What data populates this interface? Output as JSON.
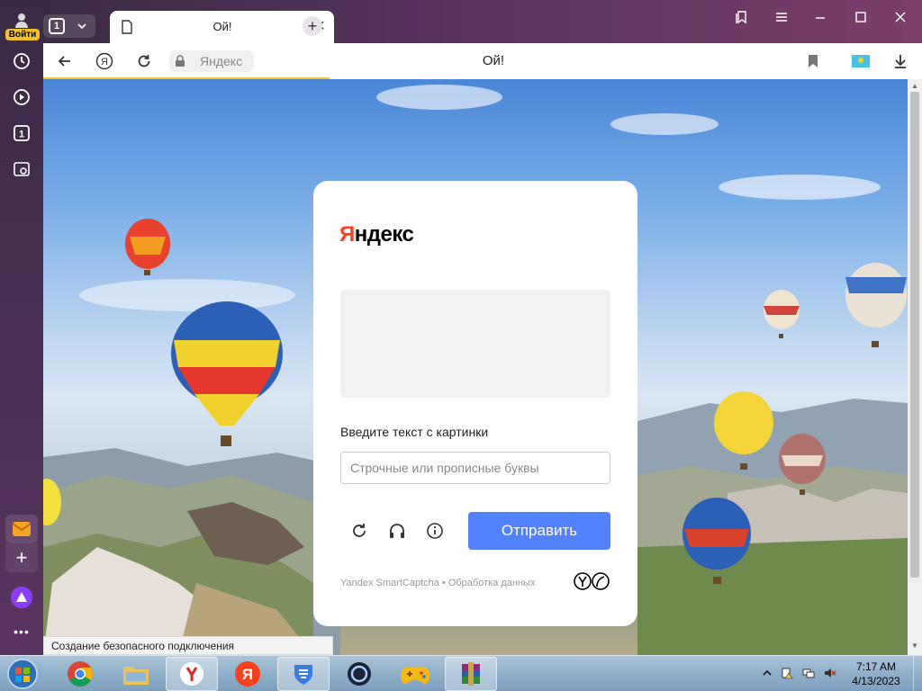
{
  "sidebar": {
    "login_label": "Войти"
  },
  "tabs": {
    "count": "1",
    "active_title": "Ой!"
  },
  "navbar": {
    "host": "Яндекс",
    "page_title": "Ой!"
  },
  "captcha": {
    "logo_first": "Я",
    "logo_rest": "ндекс",
    "prompt": "Введите текст с картинки",
    "input_placeholder": "Строчные или прописные буквы",
    "input_value": "",
    "submit_label": "Отправить",
    "footer": "Yandex SmartCaptcha • Обработка данных"
  },
  "status_bar": {
    "text": "Создание безопасного подключения"
  },
  "taskbar": {
    "time": "7:17 AM",
    "date": "4/13/2023"
  },
  "colors": {
    "accent_button": "#5282ff",
    "logo_red": "#fc3f1d",
    "login_badge": "#f5c12a"
  }
}
